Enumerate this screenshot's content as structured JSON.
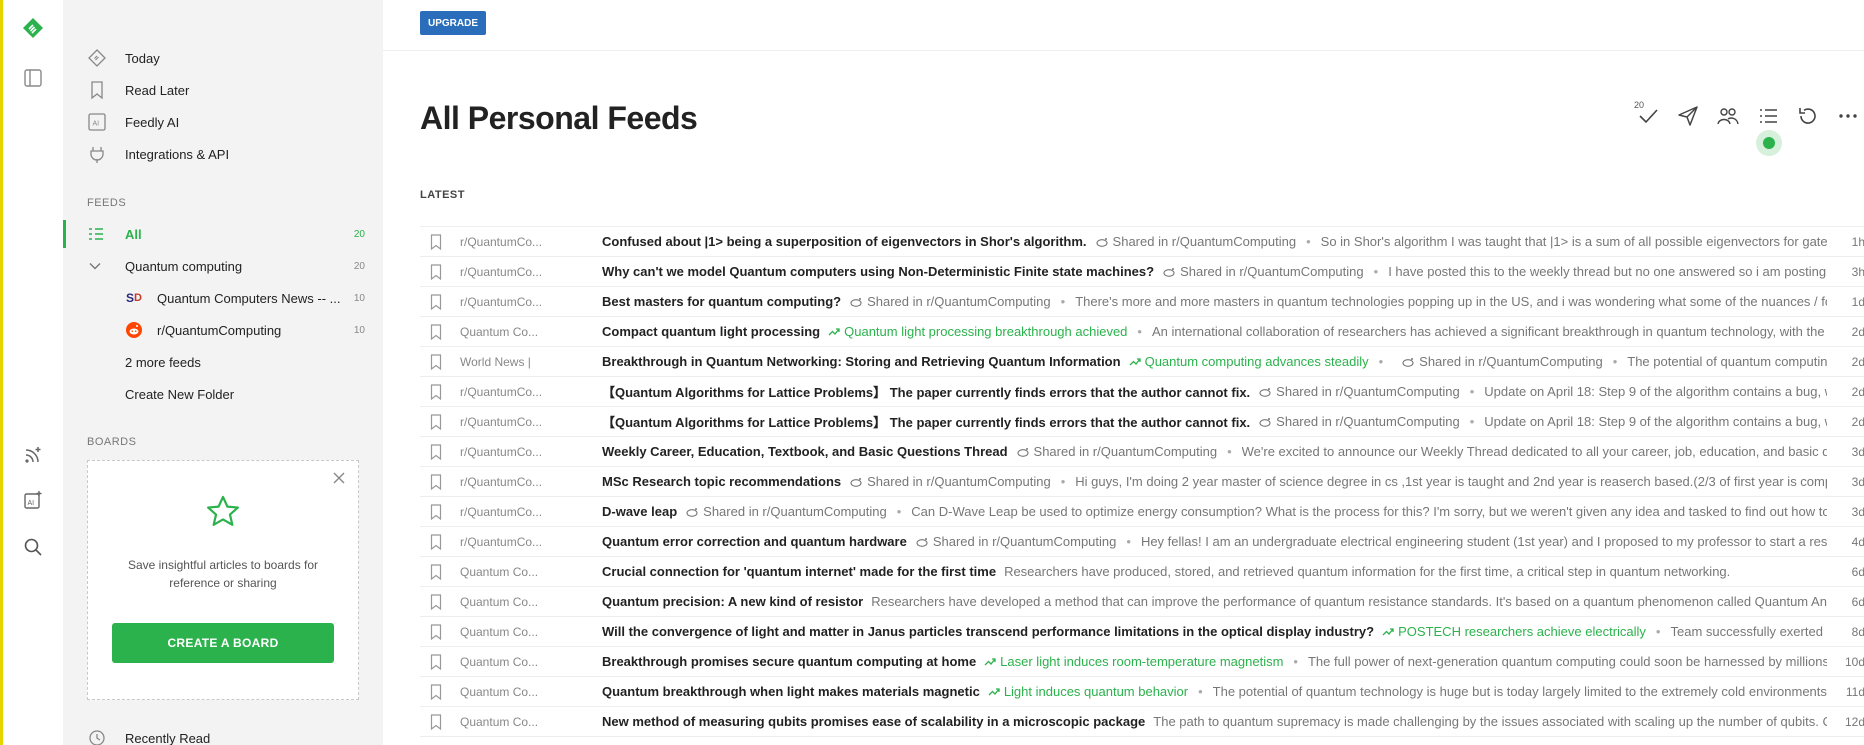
{
  "sidebar": {
    "nav": [
      {
        "label": "Today",
        "icon": "today-icon"
      },
      {
        "label": "Read Later",
        "icon": "bookmark-icon"
      },
      {
        "label": "Feedly AI",
        "icon": "ai-icon"
      },
      {
        "label": "Integrations & API",
        "icon": "plug-icon"
      }
    ],
    "feeds_label": "FEEDS",
    "feeds": {
      "all": {
        "label": "All",
        "count": "20"
      },
      "folder": {
        "label": "Quantum computing",
        "count": "20"
      },
      "sources": [
        {
          "label": "Quantum Computers News -- ...",
          "count": "10"
        },
        {
          "label": "r/QuantumComputing",
          "count": "10"
        }
      ],
      "more": "2 more feeds",
      "create_folder": "Create New Folder"
    },
    "boards_label": "BOARDS",
    "boards_card": {
      "description": "Save insightful articles to boards for reference or sharing",
      "button": "CREATE A BOARD"
    },
    "recently_read": "Recently Read"
  },
  "main": {
    "upgrade": "UPGRADE",
    "title": "All Personal Feeds",
    "mark_read_count": "20",
    "latest_label": "LATEST",
    "articles": [
      {
        "source": "r/QuantumCo...",
        "title": "Confused about |1> being a superposition of eigenvectors in Shor's algorithm.",
        "tags": [
          {
            "text": "Shared in r/QuantumComputing",
            "green": false
          }
        ],
        "snippet": "So in Shor's algorithm I was taught that |1> is a sum of all possible eigenvectors for gate",
        "age": "1h"
      },
      {
        "source": "r/QuantumCo...",
        "title": "Why can't we model Quantum computers using Non-Deterministic Finite state machines?",
        "tags": [
          {
            "text": "Shared in r/QuantumComputing",
            "green": false
          }
        ],
        "snippet": "I have posted this to the weekly thread but no one answered so i am posting i",
        "age": "3h"
      },
      {
        "source": "r/QuantumCo...",
        "title": "Best masters for quantum computing?",
        "tags": [
          {
            "text": "Shared in r/QuantumComputing",
            "green": false
          }
        ],
        "snippet": "There's more and more masters in quantum technologies popping up in the US, and i was wondering what some of the nuances / fo",
        "age": "1d"
      },
      {
        "source": "Quantum Co...",
        "title": "Compact quantum light processing",
        "tags": [
          {
            "text": "Quantum light processing breakthrough achieved",
            "green": true
          }
        ],
        "snippet": "An international collaboration of researchers has achieved a significant breakthrough in quantum technology, with the s",
        "age": "2d"
      },
      {
        "source": "World News |",
        "title": "Breakthrough in Quantum Networking: Storing and Retrieving Quantum Information",
        "tags": [
          {
            "text": "Quantum computing advances steadily",
            "green": true
          },
          {
            "text": "Shared in r/QuantumComputing",
            "green": false
          }
        ],
        "snippet": "The potential of quantum computing",
        "age": "2d"
      },
      {
        "source": "r/QuantumCo...",
        "title": "【Quantum Algorithms for Lattice Problems】 The paper currently finds errors that the author cannot fix.",
        "tags": [
          {
            "text": "Shared in r/QuantumComputing",
            "green": false
          }
        ],
        "snippet": "Update on April 18: Step 9 of the algorithm contains a bug, w",
        "age": "2d"
      },
      {
        "source": "r/QuantumCo...",
        "title": "【Quantum Algorithms for Lattice Problems】 The paper currently finds errors that the author cannot fix.",
        "tags": [
          {
            "text": "Shared in r/QuantumComputing",
            "green": false
          }
        ],
        "snippet": "Update on April 18: Step 9 of the algorithm contains a bug, w",
        "age": "2d"
      },
      {
        "source": "r/QuantumCo...",
        "title": "Weekly Career, Education, Textbook, and Basic Questions Thread",
        "tags": [
          {
            "text": "Shared in r/QuantumComputing",
            "green": false
          }
        ],
        "snippet": "We're excited to announce our Weekly Thread dedicated to all your career, job, education, and basic qu",
        "age": "3d"
      },
      {
        "source": "r/QuantumCo...",
        "title": "MSc Research topic recommendations",
        "tags": [
          {
            "text": "Shared in r/QuantumComputing",
            "green": false
          }
        ],
        "snippet": "Hi guys, I'm doing 2 year master of science degree in cs ,1st year is taught and 2nd year is reaserch based.(2/3 of first year is comp",
        "age": "3d"
      },
      {
        "source": "r/QuantumCo...",
        "title": "D-wave leap",
        "tags": [
          {
            "text": "Shared in r/QuantumComputing",
            "green": false
          }
        ],
        "snippet": "Can D-Wave Leap be used to optimize energy consumption? What is the process for this? I'm sorry, but we weren't given any idea and tasked to find out how to",
        "age": "3d"
      },
      {
        "source": "r/QuantumCo...",
        "title": "Quantum error correction and quantum hardware",
        "tags": [
          {
            "text": "Shared in r/QuantumComputing",
            "green": false
          }
        ],
        "snippet": "Hey fellas! I am an undergraduate electrical engineering student (1st year) and I proposed to my professor to start a rese",
        "age": "4d"
      },
      {
        "source": "Quantum Co...",
        "title": "Crucial connection for 'quantum internet' made for the first time",
        "tags": [],
        "snippet": "Researchers have produced, stored, and retrieved quantum information for the first time, a critical step in quantum networking.",
        "age": "6d"
      },
      {
        "source": "Quantum Co...",
        "title": "Quantum precision: A new kind of resistor",
        "tags": [],
        "snippet": "Researchers have developed a method that can improve the performance of quantum resistance standards. It's based on a quantum phenomenon called Quantum Ano",
        "age": "6d"
      },
      {
        "source": "Quantum Co...",
        "title": "Will the convergence of light and matter in Janus particles transcend performance limitations in the optical display industry?",
        "tags": [
          {
            "text": "POSTECH researchers achieve electrically",
            "green": true
          }
        ],
        "snippet": "Team successfully exerted e",
        "age": "8d"
      },
      {
        "source": "Quantum Co...",
        "title": "Breakthrough promises secure quantum computing at home",
        "tags": [
          {
            "text": "Laser light induces room-temperature magnetism",
            "green": true
          }
        ],
        "snippet": "The full power of next-generation quantum computing could soon be harnessed by millions",
        "age": "10d"
      },
      {
        "source": "Quantum Co...",
        "title": "Quantum breakthrough when light makes materials magnetic",
        "tags": [
          {
            "text": "Light induces quantum behavior",
            "green": true
          }
        ],
        "snippet": "The potential of quantum technology is huge but is today largely limited to the extremely cold environments",
        "age": "11d"
      },
      {
        "source": "Quantum Co...",
        "title": "New method of measuring qubits promises ease of scalability in a microscopic package",
        "tags": [],
        "snippet": "The path to quantum supremacy is made challenging by the issues associated with scaling up the number of qubits. C",
        "age": "12d"
      }
    ]
  },
  "colors": {
    "accent": "#2bb24c",
    "upgrade": "#2a6ebb"
  }
}
